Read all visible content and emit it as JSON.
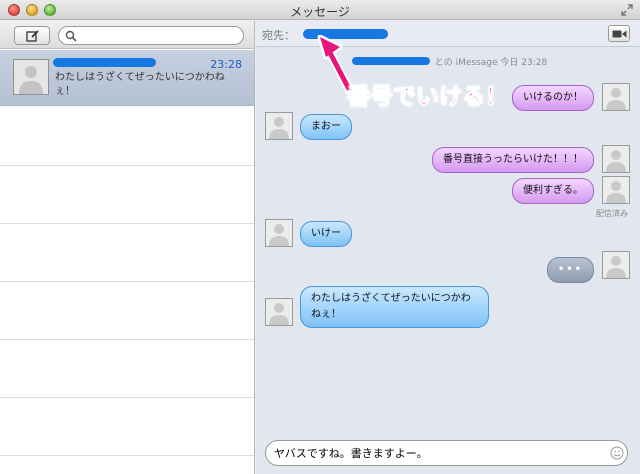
{
  "window": {
    "title": "メッセージ"
  },
  "sidebar": {
    "search_placeholder": "",
    "conversations": [
      {
        "time": "23:28",
        "preview": "わたしはうざくてぜったいにつかわねぇ！"
      }
    ]
  },
  "chat": {
    "to_label": "宛先：",
    "header": "との iMessage 今日 23:28",
    "annotation": "番号でいける！",
    "messages": [
      {
        "side": "right",
        "text": "いけるのか！"
      },
      {
        "side": "left",
        "text": "まおー"
      },
      {
        "side": "right",
        "text": "番号直接うったらいけた！！！"
      },
      {
        "side": "right",
        "text": "便利すぎる。"
      },
      {
        "side": "left",
        "text": "いけー"
      },
      {
        "side": "right",
        "text": "•••"
      },
      {
        "side": "left",
        "text": "わたしはうざくてぜったいにつかわねぇ！"
      }
    ],
    "delivered_label": "配信済み",
    "input_value": "ヤバスですね。書きますよー。"
  },
  "icons": {
    "compose": "compose-icon",
    "search": "search-icon",
    "video": "video-camera-icon",
    "emoji": "emoji-icon",
    "fullscreen": "fullscreen-icon"
  },
  "colors": {
    "accent_blue": "#1778e2",
    "annotation_pink": "#e8157a",
    "imessage_bubble_blue": "#7ec3f7",
    "self_bubble_purple": "#d59af2"
  }
}
